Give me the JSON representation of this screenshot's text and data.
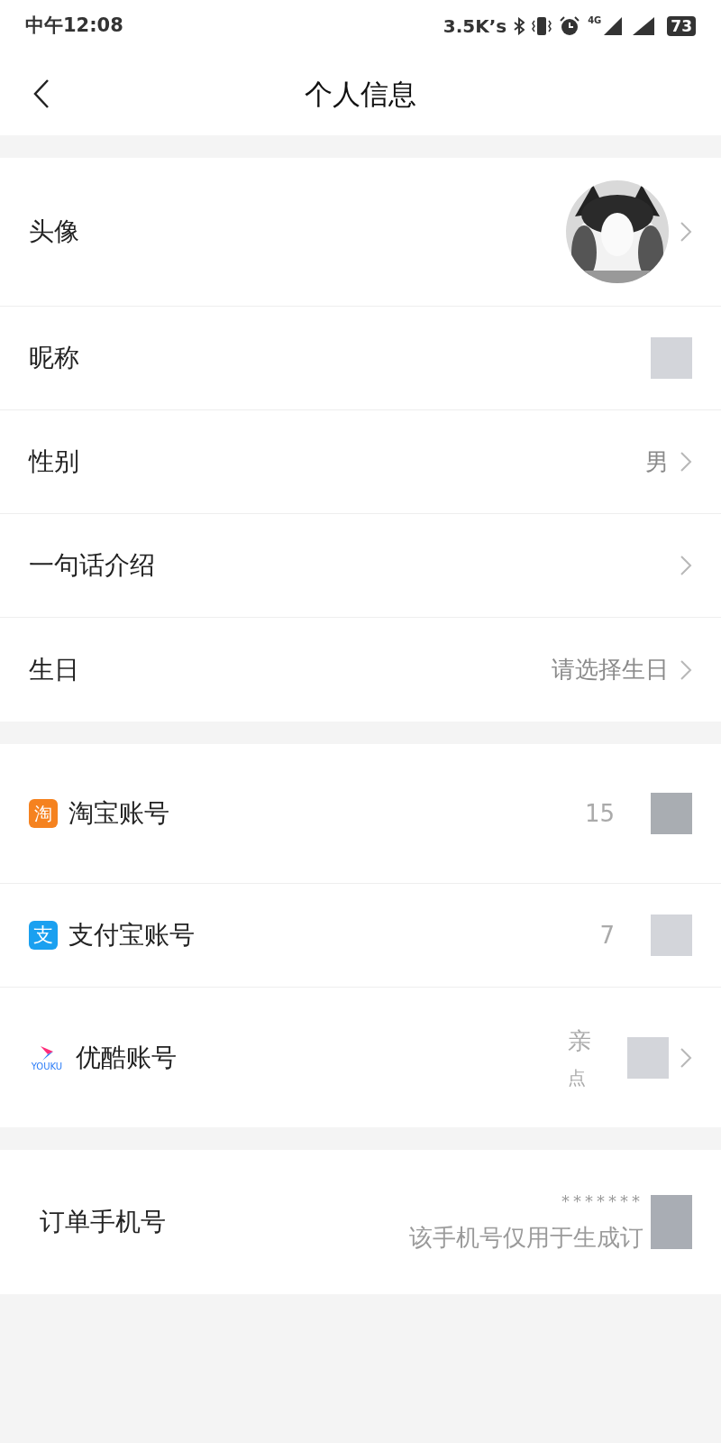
{
  "status_bar": {
    "time": "中午12:08",
    "net_speed": "3.5K’s",
    "network": "4G",
    "battery": "73"
  },
  "header": {
    "title": "个人信息"
  },
  "sections": [
    {
      "rows": [
        {
          "kind": "avatar",
          "label": "头像",
          "chevron": true
        },
        {
          "kind": "masked",
          "label": "昵称",
          "chevron": false,
          "values": []
        },
        {
          "kind": "text",
          "label": "性别",
          "value": "男",
          "chevron": true
        },
        {
          "kind": "text",
          "label": "一句话介绍",
          "chevron": true
        },
        {
          "kind": "text",
          "label": "生日",
          "value": "请选择生日",
          "chevron": true
        }
      ]
    },
    {
      "rows": [
        {
          "kind": "masked",
          "label": "淘宝账号",
          "icon": {
            "kind": "taobao",
            "glyph": "淘"
          },
          "chevron": false,
          "values": [
            "15"
          ]
        },
        {
          "kind": "masked",
          "label": "支付宝账号",
          "icon": {
            "kind": "alipay",
            "glyph": "支"
          },
          "chevron": false,
          "values": [
            "7"
          ]
        },
        {
          "kind": "masked",
          "label": "优酷账号",
          "icon": {
            "kind": "youku",
            "glyph": "YOUKU"
          },
          "chevron": true,
          "values": [
            "亲",
            "点"
          ]
        }
      ]
    },
    {
      "rows": [
        {
          "kind": "phone",
          "label": "订单手机号",
          "chevron": false,
          "values": [
            "*******",
            "该手机号仅用于生成订"
          ]
        }
      ]
    }
  ]
}
